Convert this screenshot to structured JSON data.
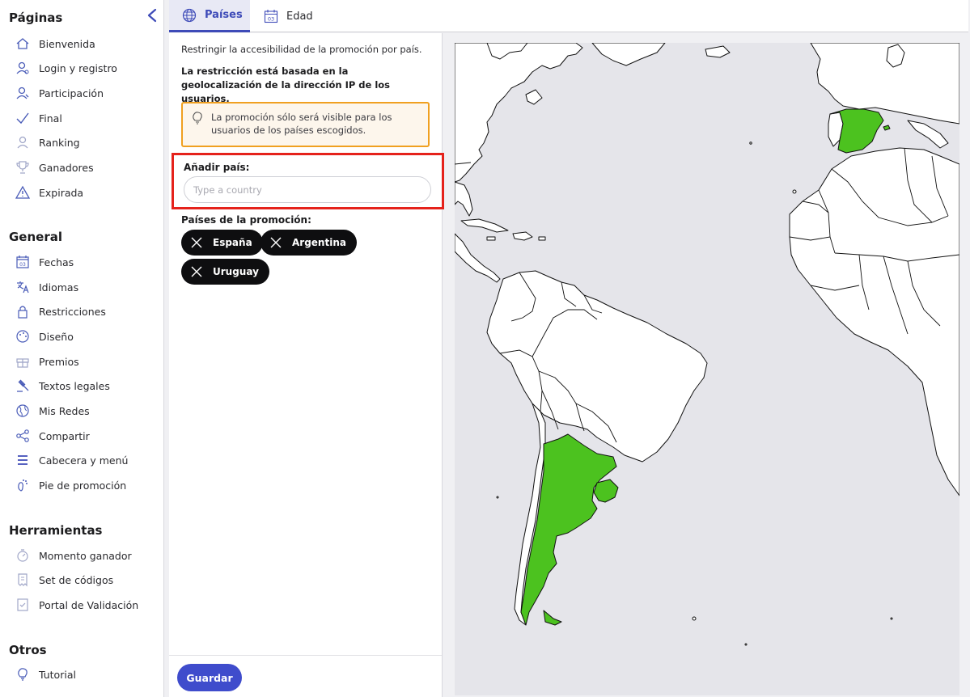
{
  "sidebar": {
    "sections": [
      {
        "title": "Páginas",
        "items": [
          {
            "label": "Bienvenida",
            "icon": "home-icon"
          },
          {
            "label": "Login y registro",
            "icon": "user-icon"
          },
          {
            "label": "Participación",
            "icon": "user-edit-icon"
          },
          {
            "label": "Final",
            "icon": "check-icon"
          },
          {
            "label": "Ranking",
            "icon": "ranking-icon"
          },
          {
            "label": "Ganadores",
            "icon": "trophy-icon"
          },
          {
            "label": "Expirada",
            "icon": "warning-icon"
          }
        ]
      },
      {
        "title": "General",
        "items": [
          {
            "label": "Fechas",
            "icon": "calendar-icon"
          },
          {
            "label": "Idiomas",
            "icon": "translate-icon"
          },
          {
            "label": "Restricciones",
            "icon": "lock-icon"
          },
          {
            "label": "Diseño",
            "icon": "palette-icon"
          },
          {
            "label": "Premios",
            "icon": "gift-icon"
          },
          {
            "label": "Textos legales",
            "icon": "gavel-icon"
          },
          {
            "label": "Mis Redes",
            "icon": "globe-icon"
          },
          {
            "label": "Compartir",
            "icon": "share-icon"
          },
          {
            "label": "Cabecera y menú",
            "icon": "menu-icon"
          },
          {
            "label": "Pie de promoción",
            "icon": "footprint-icon"
          }
        ]
      },
      {
        "title": "Herramientas",
        "items": [
          {
            "label": "Momento ganador",
            "icon": "timer-icon"
          },
          {
            "label": "Set de códigos",
            "icon": "ticket-icon"
          },
          {
            "label": "Portal de Validación",
            "icon": "portal-icon"
          }
        ]
      },
      {
        "title": "Otros",
        "items": [
          {
            "label": "Tutorial",
            "icon": "lightbulb-icon"
          }
        ]
      }
    ]
  },
  "tabs": [
    {
      "label": "Países",
      "icon": "globe-icon",
      "active": true
    },
    {
      "label": "Edad",
      "icon": "calendar-icon",
      "active": false
    }
  ],
  "panel": {
    "intro": "Restringir la accesibilidad de la promoción por país.",
    "note": "La restricción está basada en la geolocalización de la dirección IP de los usuarios.",
    "info": "La promoción sólo será visible para los usuarios de los países escogidos.",
    "add_label": "Añadir país:",
    "add_placeholder": "Type a country",
    "chips_label": "Países de la promoción:",
    "chips": [
      "España",
      "Argentina",
      "Uruguay"
    ],
    "save_label": "Guardar"
  },
  "map": {
    "selected_countries": [
      "España",
      "Argentina",
      "Uruguay"
    ],
    "selected_color": "#4cc21f",
    "ocean_color": "#e5e5ea",
    "land_color": "#ffffff"
  },
  "colors": {
    "accent": "#3e4bb8",
    "warning_border": "#f0a020",
    "highlight_border": "#e5221b"
  }
}
